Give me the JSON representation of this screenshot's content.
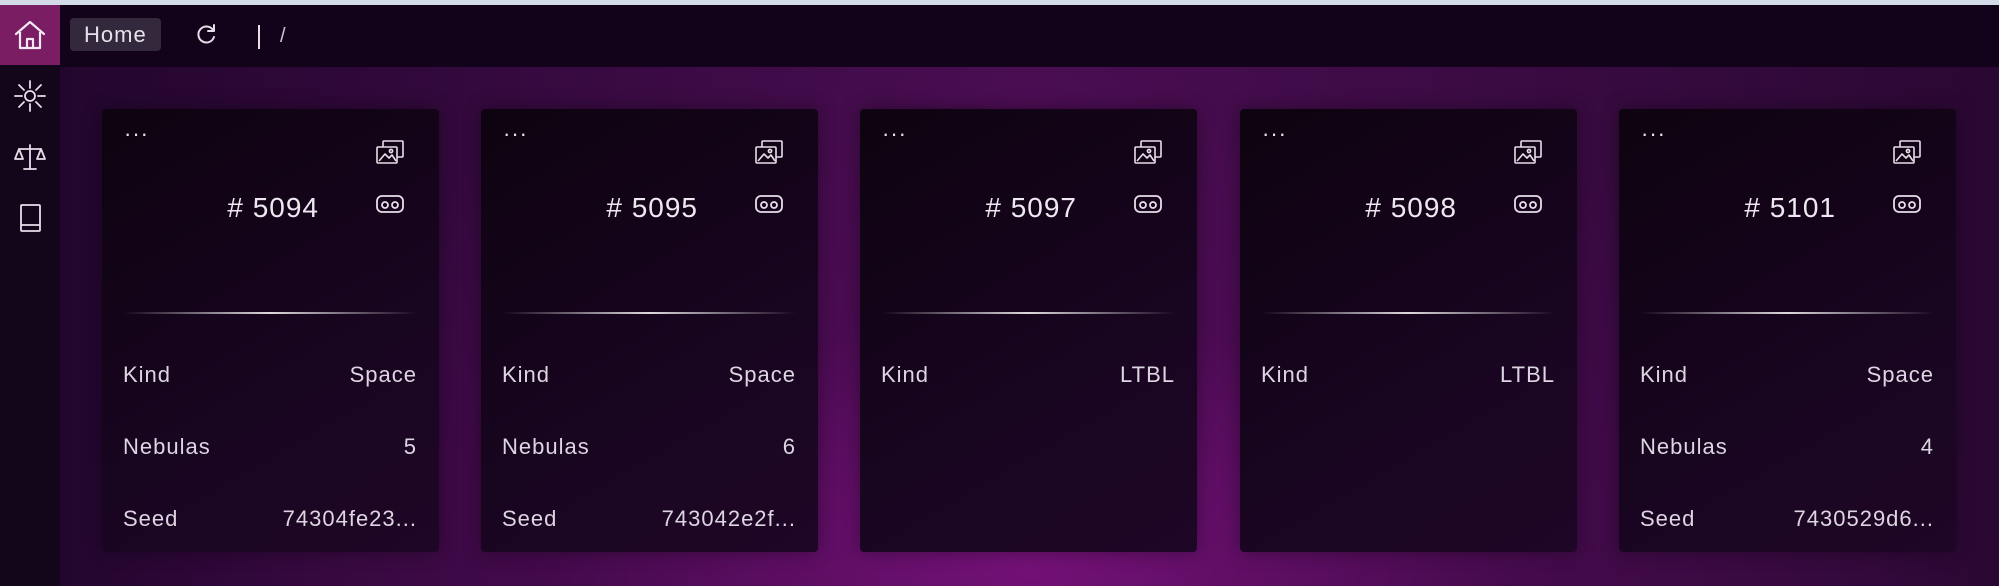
{
  "colors": {
    "active_nav": "#7a1d63",
    "background": "#0d0410",
    "card": "#150519",
    "text": "#e7e3ea"
  },
  "sidebar": {
    "items": [
      {
        "icon": "home-icon",
        "active": true
      },
      {
        "icon": "nebula-icon",
        "active": false
      },
      {
        "icon": "scale-icon",
        "active": false
      },
      {
        "icon": "book-icon",
        "active": false
      }
    ]
  },
  "topbar": {
    "home_label": "Home",
    "refresh_icon": "refresh-icon",
    "path": "/"
  },
  "cards": [
    {
      "dots": "···",
      "id": "# 5094",
      "kind_label": "Kind",
      "kind": "Space",
      "nebulas_label": "Nebulas",
      "nebulas": "5",
      "seed_label": "Seed",
      "seed": "74304fe23..."
    },
    {
      "dots": "···",
      "id": "# 5095",
      "kind_label": "Kind",
      "kind": "Space",
      "nebulas_label": "Nebulas",
      "nebulas": "6",
      "seed_label": "Seed",
      "seed": "743042e2f..."
    },
    {
      "dots": "···",
      "id": "# 5097",
      "kind_label": "Kind",
      "kind": "LTBL"
    },
    {
      "dots": "···",
      "id": "# 5098",
      "kind_label": "Kind",
      "kind": "LTBL"
    },
    {
      "dots": "···",
      "id": "# 5101",
      "kind_label": "Kind",
      "kind": "Space",
      "nebulas_label": "Nebulas",
      "nebulas": "4",
      "seed_label": "Seed",
      "seed": "7430529d6..."
    }
  ]
}
